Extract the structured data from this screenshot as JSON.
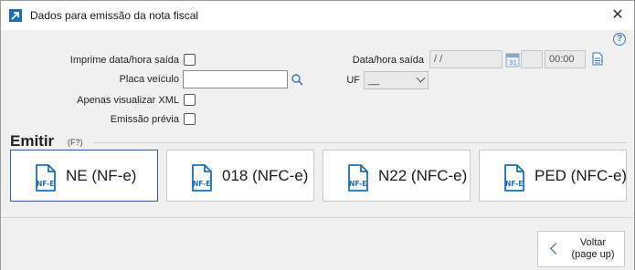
{
  "window": {
    "title": "Dados para emissão da nota fiscal",
    "close_glyph": "✕"
  },
  "form": {
    "help_glyph": "?",
    "print_datetime_label": "Imprime data/hora saída",
    "print_datetime_checked": false,
    "plate_label": "Placa veículo",
    "plate_value": "",
    "xml_only_label": "Apenas visualizar XML",
    "xml_only_checked": false,
    "preview_label": "Emissão prévia",
    "preview_checked": false,
    "exit_datetime_label": "Data/hora saída",
    "exit_date_value": " / /",
    "exit_time_value": "00:00",
    "uf_label": "UF",
    "uf_value": "__"
  },
  "emit": {
    "title": "Emitir",
    "shortcut": "(F?)",
    "icon_text": "NF-E",
    "buttons": [
      {
        "label": "NE (NF-e)"
      },
      {
        "label": "018 (NFC-e)"
      },
      {
        "label": "N22 (NFC-e)"
      },
      {
        "label": "PED (NFC-e)"
      }
    ]
  },
  "footer": {
    "back_label": "Voltar\n(page up)",
    "back_line1": "Voltar",
    "back_line2": "(page up)"
  },
  "colors": {
    "accent": "#1c6fb3",
    "primary_border": "#2f5f93",
    "panel_bg": "#f0f0f0"
  }
}
